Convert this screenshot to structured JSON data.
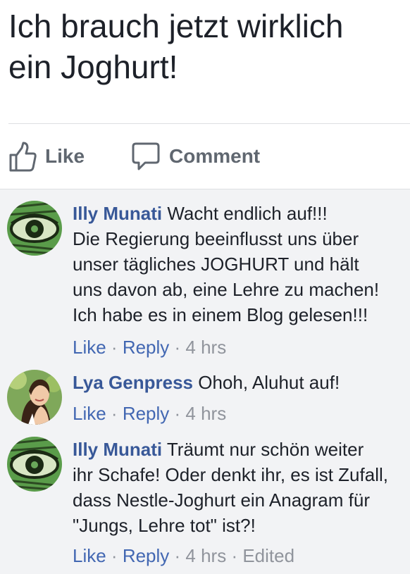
{
  "post": {
    "text": "Ich brauch jetzt wirklich\n ein Joghurt!"
  },
  "actions": {
    "like_label": "Like",
    "comment_label": "Comment"
  },
  "comments": [
    {
      "author": "Illy Munati",
      "text": "Wacht endlich auf!!!\n Die Regierung beeinflusst uns über\n unser tägliches JOGHURT und hält\n uns davon ab, eine Lehre zu machen!\nIch habe es in einem Blog gelesen!!!",
      "like_label": "Like",
      "reply_label": "Reply",
      "separator": " · ",
      "time": "4 hrs",
      "edited": ""
    },
    {
      "author": "Lya Genpress",
      "text": "Ohoh, Aluhut auf!",
      "like_label": "Like",
      "reply_label": "Reply",
      "separator": " · ",
      "time": "4 hrs",
      "edited": ""
    },
    {
      "author": "Illy Munati",
      "text": "Träumt nur schön weiter\n ihr Schafe! Oder denkt ihr, es ist Zufall,\ndass Nestle-Joghurt ein Anagram für\n\"Jungs, Lehre tot\" ist?!",
      "like_label": "Like",
      "reply_label": "Reply",
      "separator": " · ",
      "time": "4 hrs",
      "edited": "Edited"
    }
  ],
  "colors": {
    "link_blue": "#4267b2",
    "author_blue": "#385898",
    "meta_gray": "#90949c",
    "comments_bg": "#f2f3f5"
  },
  "icons": {
    "like": "thumbs-up-icon",
    "comment": "speech-bubble-icon",
    "avatar_illy": "eye-avatar-icon"
  }
}
